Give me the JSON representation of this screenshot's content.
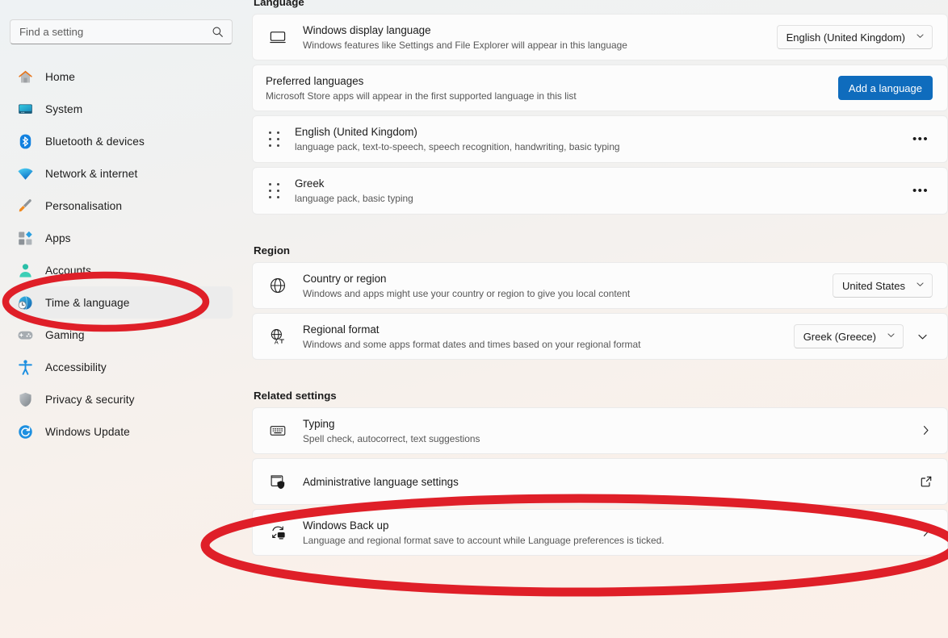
{
  "search": {
    "placeholder": "Find a setting",
    "value": "",
    "icon": "search-icon"
  },
  "sidebar": {
    "items": [
      {
        "label": "Home",
        "icon": "home-icon",
        "selected": false
      },
      {
        "label": "System",
        "icon": "system-monitor-icon",
        "selected": false
      },
      {
        "label": "Bluetooth & devices",
        "icon": "bluetooth-icon",
        "selected": false
      },
      {
        "label": "Network & internet",
        "icon": "wifi-icon",
        "selected": false
      },
      {
        "label": "Personalisation",
        "icon": "paintbrush-icon",
        "selected": false
      },
      {
        "label": "Apps",
        "icon": "apps-icon",
        "selected": false
      },
      {
        "label": "Accounts",
        "icon": "account-person-icon",
        "selected": false
      },
      {
        "label": "Time & language",
        "icon": "clock-globe-icon",
        "selected": true
      },
      {
        "label": "Gaming",
        "icon": "gamepad-icon",
        "selected": false
      },
      {
        "label": "Accessibility",
        "icon": "accessibility-person-icon",
        "selected": false
      },
      {
        "label": "Privacy & security",
        "icon": "shield-icon",
        "selected": false
      },
      {
        "label": "Windows Update",
        "icon": "update-refresh-icon",
        "selected": false
      }
    ]
  },
  "main": {
    "sections": [
      {
        "id": "language",
        "heading": "Language",
        "rows": [
          {
            "id": "windows-display-language",
            "title": "Windows display language",
            "subtitle": "Windows features like Settings and File Explorer will appear in this language",
            "icon": "monitor-icon",
            "control": "dropdown",
            "value": "English (United Kingdom)"
          },
          {
            "id": "preferred-languages",
            "title": "Preferred languages",
            "subtitle": "Microsoft Store apps will appear in the first supported language in this list",
            "icon": "none",
            "control": "button",
            "value": "Add a language"
          },
          {
            "id": "language-english-uk",
            "title": "English (United Kingdom)",
            "subtitle": "language pack, text-to-speech, speech recognition, handwriting, basic typing",
            "icon": "drag-handle-icon",
            "control": "ellipsis",
            "value": "•••"
          },
          {
            "id": "language-greek",
            "title": "Greek",
            "subtitle": "language pack, basic typing",
            "icon": "drag-handle-icon",
            "control": "ellipsis",
            "value": "•••"
          }
        ]
      },
      {
        "id": "region",
        "heading": "Region",
        "rows": [
          {
            "id": "country-or-region",
            "title": "Country or region",
            "subtitle": "Windows and apps might use your country or region to give you local content",
            "icon": "globe-icon",
            "control": "dropdown",
            "value": "United States"
          },
          {
            "id": "regional-format",
            "title": "Regional format",
            "subtitle": "Windows and some apps format dates and times based on your regional format",
            "icon": "globe-translate-icon",
            "control": "dropdown-expander",
            "value": "Greek (Greece)"
          }
        ]
      },
      {
        "id": "related-settings",
        "heading": "Related settings",
        "rows": [
          {
            "id": "typing",
            "title": "Typing",
            "subtitle": "Spell check, autocorrect, text suggestions",
            "icon": "keyboard-icon",
            "control": "chevron",
            "value": ""
          },
          {
            "id": "administrative-language-settings",
            "title": "Administrative language settings",
            "subtitle": "",
            "icon": "admin-shield-window-icon",
            "control": "external-link",
            "value": ""
          },
          {
            "id": "windows-back-up",
            "title": "Windows Back up",
            "subtitle": "Language and regional format save to account while Language preferences is ticked.",
            "icon": "backup-icon",
            "control": "chevron",
            "value": ""
          }
        ]
      }
    ]
  },
  "annotations": {
    "color": "#DF1F28",
    "shapes": [
      {
        "name": "ellipse-time-and-language",
        "target": "sidebar-item-time-language"
      },
      {
        "name": "ellipse-administrative-language-settings",
        "target": "row-administrative-language-settings"
      }
    ]
  },
  "colors": {
    "accent": "#0f6cbd",
    "annotation_red": "#DF1F28",
    "card_bg": "#fcfcfc",
    "selected_nav_bg": "#ececec"
  }
}
